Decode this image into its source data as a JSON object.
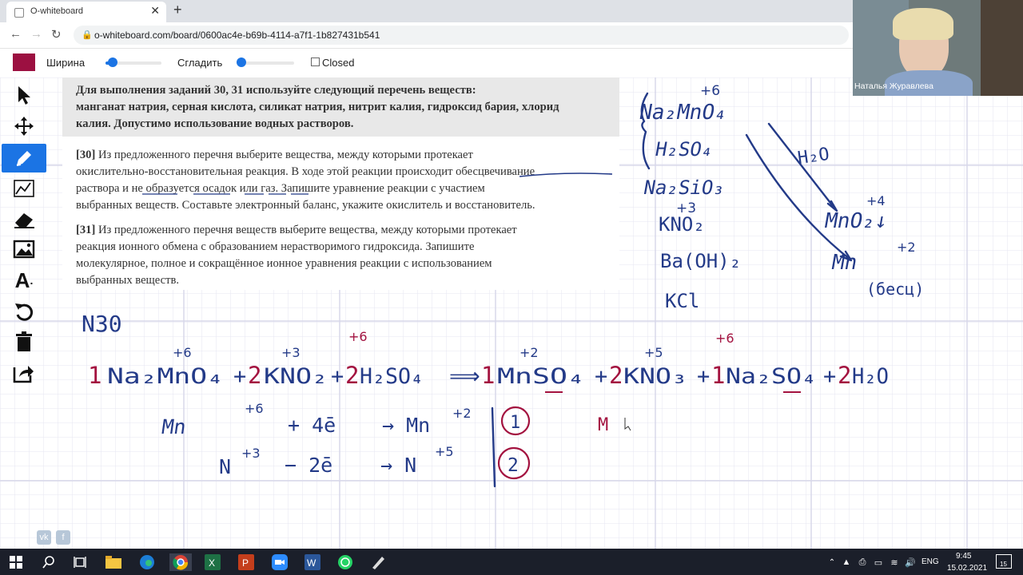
{
  "browser": {
    "tab_title": "O-whiteboard",
    "url": "o-whiteboard.com/board/0600ac4e-b69b-4114-a7f1-1b827431b541"
  },
  "toolbar": {
    "color": "#9c1041",
    "width_label": "Ширина",
    "width_value": 0.07,
    "smooth_label": "Сгладить",
    "smooth_value": 0.0,
    "closed_label": "Closed"
  },
  "tools": [
    "pointer-icon",
    "move-icon",
    "pen-icon",
    "shape-icon",
    "eraser-icon",
    "image-icon",
    "text-icon",
    "undo-icon",
    "trash-icon",
    "share-icon"
  ],
  "problem": {
    "intro_a": "Для выполнения заданий ",
    "intro_nums": "30, 31",
    "intro_b": " используйте следующий перечень веществ:",
    "intro_line2": "манганат натрия, серная кислота, силикат натрия, нитрит калия, гидроксид бария, хлорид",
    "intro_line3": "калия. Допустимо использование водных растворов.",
    "q30_num": "[30]",
    "q30_line1": " Из предложенного перечня выберите вещества, между которыми протекает",
    "q30_line2": "окислительно-восстановительная реакция. В ходе этой реакции происходит обесцвечивание",
    "q30_line3": "раствора и не образуется осадок или газ. Запишите уравнение реакции с участием",
    "q30_line4": "выбранных веществ. Составьте электронный баланс, укажите окислитель и восстановитель.",
    "q31_num": "[31]",
    "q31_line1": " Из предложенного перечня веществ выберите вещества, между которыми протекает",
    "q31_line2": "реакция ионного обмена с образованием нерастворимого гидроксида. Запишите",
    "q31_line3": "молекулярное, полное и сокращённое ионное уравнения реакции с использованием",
    "q31_line4": "выбранных веществ."
  },
  "webcam": {
    "name": "Наталья Журавлева"
  },
  "social": [
    "vk",
    "f"
  ],
  "taskbar": {
    "lang": "ENG",
    "time": "9:45",
    "date": "15.02.2021",
    "notif_count": "15"
  },
  "colors": {
    "ink_blue": "#233a88",
    "ink_red": "#a3123f",
    "tool_active": "#1b74e4"
  }
}
